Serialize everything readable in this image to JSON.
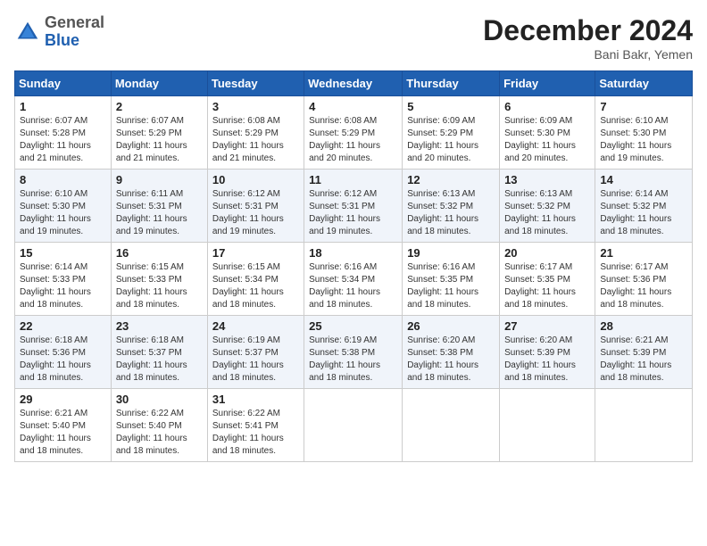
{
  "header": {
    "logo_general": "General",
    "logo_blue": "Blue",
    "month_title": "December 2024",
    "location": "Bani Bakr, Yemen"
  },
  "calendar": {
    "days_of_week": [
      "Sunday",
      "Monday",
      "Tuesday",
      "Wednesday",
      "Thursday",
      "Friday",
      "Saturday"
    ],
    "weeks": [
      [
        {
          "day": "1",
          "sunrise": "6:07 AM",
          "sunset": "5:28 PM",
          "daylight": "11 hours and 21 minutes."
        },
        {
          "day": "2",
          "sunrise": "6:07 AM",
          "sunset": "5:29 PM",
          "daylight": "11 hours and 21 minutes."
        },
        {
          "day": "3",
          "sunrise": "6:08 AM",
          "sunset": "5:29 PM",
          "daylight": "11 hours and 21 minutes."
        },
        {
          "day": "4",
          "sunrise": "6:08 AM",
          "sunset": "5:29 PM",
          "daylight": "11 hours and 20 minutes."
        },
        {
          "day": "5",
          "sunrise": "6:09 AM",
          "sunset": "5:29 PM",
          "daylight": "11 hours and 20 minutes."
        },
        {
          "day": "6",
          "sunrise": "6:09 AM",
          "sunset": "5:30 PM",
          "daylight": "11 hours and 20 minutes."
        },
        {
          "day": "7",
          "sunrise": "6:10 AM",
          "sunset": "5:30 PM",
          "daylight": "11 hours and 19 minutes."
        }
      ],
      [
        {
          "day": "8",
          "sunrise": "6:10 AM",
          "sunset": "5:30 PM",
          "daylight": "11 hours and 19 minutes."
        },
        {
          "day": "9",
          "sunrise": "6:11 AM",
          "sunset": "5:31 PM",
          "daylight": "11 hours and 19 minutes."
        },
        {
          "day": "10",
          "sunrise": "6:12 AM",
          "sunset": "5:31 PM",
          "daylight": "11 hours and 19 minutes."
        },
        {
          "day": "11",
          "sunrise": "6:12 AM",
          "sunset": "5:31 PM",
          "daylight": "11 hours and 19 minutes."
        },
        {
          "day": "12",
          "sunrise": "6:13 AM",
          "sunset": "5:32 PM",
          "daylight": "11 hours and 18 minutes."
        },
        {
          "day": "13",
          "sunrise": "6:13 AM",
          "sunset": "5:32 PM",
          "daylight": "11 hours and 18 minutes."
        },
        {
          "day": "14",
          "sunrise": "6:14 AM",
          "sunset": "5:32 PM",
          "daylight": "11 hours and 18 minutes."
        }
      ],
      [
        {
          "day": "15",
          "sunrise": "6:14 AM",
          "sunset": "5:33 PM",
          "daylight": "11 hours and 18 minutes."
        },
        {
          "day": "16",
          "sunrise": "6:15 AM",
          "sunset": "5:33 PM",
          "daylight": "11 hours and 18 minutes."
        },
        {
          "day": "17",
          "sunrise": "6:15 AM",
          "sunset": "5:34 PM",
          "daylight": "11 hours and 18 minutes."
        },
        {
          "day": "18",
          "sunrise": "6:16 AM",
          "sunset": "5:34 PM",
          "daylight": "11 hours and 18 minutes."
        },
        {
          "day": "19",
          "sunrise": "6:16 AM",
          "sunset": "5:35 PM",
          "daylight": "11 hours and 18 minutes."
        },
        {
          "day": "20",
          "sunrise": "6:17 AM",
          "sunset": "5:35 PM",
          "daylight": "11 hours and 18 minutes."
        },
        {
          "day": "21",
          "sunrise": "6:17 AM",
          "sunset": "5:36 PM",
          "daylight": "11 hours and 18 minutes."
        }
      ],
      [
        {
          "day": "22",
          "sunrise": "6:18 AM",
          "sunset": "5:36 PM",
          "daylight": "11 hours and 18 minutes."
        },
        {
          "day": "23",
          "sunrise": "6:18 AM",
          "sunset": "5:37 PM",
          "daylight": "11 hours and 18 minutes."
        },
        {
          "day": "24",
          "sunrise": "6:19 AM",
          "sunset": "5:37 PM",
          "daylight": "11 hours and 18 minutes."
        },
        {
          "day": "25",
          "sunrise": "6:19 AM",
          "sunset": "5:38 PM",
          "daylight": "11 hours and 18 minutes."
        },
        {
          "day": "26",
          "sunrise": "6:20 AM",
          "sunset": "5:38 PM",
          "daylight": "11 hours and 18 minutes."
        },
        {
          "day": "27",
          "sunrise": "6:20 AM",
          "sunset": "5:39 PM",
          "daylight": "11 hours and 18 minutes."
        },
        {
          "day": "28",
          "sunrise": "6:21 AM",
          "sunset": "5:39 PM",
          "daylight": "11 hours and 18 minutes."
        }
      ],
      [
        {
          "day": "29",
          "sunrise": "6:21 AM",
          "sunset": "5:40 PM",
          "daylight": "11 hours and 18 minutes."
        },
        {
          "day": "30",
          "sunrise": "6:22 AM",
          "sunset": "5:40 PM",
          "daylight": "11 hours and 18 minutes."
        },
        {
          "day": "31",
          "sunrise": "6:22 AM",
          "sunset": "5:41 PM",
          "daylight": "11 hours and 18 minutes."
        },
        null,
        null,
        null,
        null
      ]
    ]
  }
}
